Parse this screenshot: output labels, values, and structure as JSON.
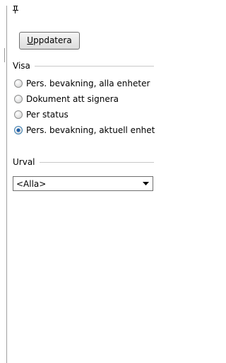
{
  "toolbar": {
    "pin_icon": "pin-icon",
    "update_label": "Uppdatera",
    "update_accel": "U"
  },
  "view_group": {
    "title": "Visa",
    "options": [
      {
        "label": "Pers. bevakning, alla enheter",
        "selected": false
      },
      {
        "label": "Dokument att signera",
        "selected": false
      },
      {
        "label": "Per status",
        "selected": false
      },
      {
        "label": "Pers. bevakning, aktuell enhet",
        "selected": true
      }
    ]
  },
  "selection_group": {
    "title": "Urval",
    "selected_value": "<Alla>"
  }
}
